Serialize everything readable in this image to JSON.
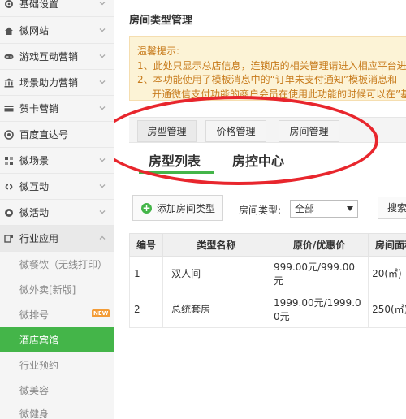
{
  "sidebar": {
    "items": [
      {
        "label": "基础设置",
        "icon": "settings-icon"
      },
      {
        "label": "微网站",
        "icon": "home-icon"
      },
      {
        "label": "游戏互动营销",
        "icon": "gamepad-icon"
      },
      {
        "label": "场景助力营销",
        "icon": "bank-icon"
      },
      {
        "label": "贺卡营销",
        "icon": "card-icon"
      },
      {
        "label": "百度直达号",
        "icon": "baidu-icon"
      },
      {
        "label": "微场景",
        "icon": "scene-icon"
      },
      {
        "label": "微互动",
        "icon": "link-icon"
      },
      {
        "label": "微活动",
        "icon": "activity-icon"
      },
      {
        "label": "行业应用",
        "icon": "app-icon"
      }
    ],
    "sub_items": [
      {
        "label": "微餐饮（无线打印）"
      },
      {
        "label": "微外卖[新版]"
      },
      {
        "label": "微排号",
        "badge": "NEW"
      },
      {
        "label": "酒店宾馆"
      },
      {
        "label": "行业预约"
      },
      {
        "label": "微美容"
      },
      {
        "label": "微健身"
      }
    ]
  },
  "main": {
    "title": "房间类型管理",
    "notice": {
      "heading": "温馨提示:",
      "line1": "1、此处只显示总店信息，连锁店的相关管理请进入相应平台进",
      "line2": "2、本功能使用了模板消息中的“订单未支付通知”模板消息和",
      "line3": "开通微信支付功能的商户会员在使用此功能的时候可以在”基本"
    },
    "tabs": [
      "房型管理",
      "价格管理",
      "房间管理"
    ],
    "subtabs": [
      "房型列表",
      "房控中心"
    ],
    "toolbar": {
      "add_label": "添加房间类型",
      "filter_label": "房间类型:",
      "filter_value": "全部",
      "search_label": "搜索"
    },
    "table": {
      "headers": [
        "编号",
        "类型名称",
        "原价/优惠价",
        "房间面积"
      ],
      "rows": [
        {
          "no": "1",
          "name": "双人间",
          "price_a": "999.00元/999.00",
          "price_b": "元",
          "area": "20(㎡)"
        },
        {
          "no": "2",
          "name": "总统套房",
          "price_a": "1999.00元/1999.0",
          "price_b": "0元",
          "area": "250(㎡)"
        }
      ]
    }
  },
  "colors": {
    "accent": "#44b549",
    "annotation": "#e8262d",
    "notice_text": "#c77b1c",
    "notice_bg": "#fcf3d6"
  }
}
